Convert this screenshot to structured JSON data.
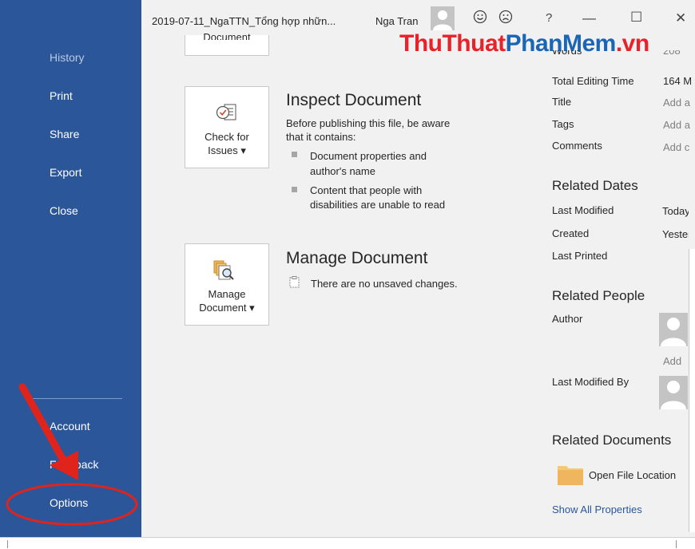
{
  "titlebar": {
    "doc_title": "2019-07-11_NgaTTN_Tổng hợp nhữn...",
    "user_name": "Nga Tran",
    "help_glyph": "?",
    "minimize_glyph": "—",
    "restore_glyph": "☐",
    "close_glyph": "✕",
    "icons": [
      "smile-icon",
      "frown-icon",
      "help-icon"
    ]
  },
  "watermark": {
    "part1": "ThuThuat",
    "part2": "PhanMem",
    "part3": ".vn"
  },
  "nav": {
    "history": "History",
    "print": "Print",
    "share": "Share",
    "export": "Export",
    "close": "Close",
    "account": "Account",
    "feedback": "Feedback",
    "options": "Options"
  },
  "top_tile": {
    "label": "Document"
  },
  "inspect": {
    "button_line1": "Check for",
    "button_line2": "Issues ▾",
    "title": "Inspect Document",
    "desc_line1": "Before publishing this file, be aware",
    "desc_line2": "that it contains:",
    "bullets": [
      {
        "line1": "Document properties and",
        "line2": "author's name"
      },
      {
        "line1": "Content that people with",
        "line2": "disabilities are unable to read"
      }
    ]
  },
  "manage": {
    "button_line1": "Manage",
    "button_line2": "Document ▾",
    "title": "Manage Document",
    "status": "There are no unsaved changes."
  },
  "properties": {
    "words_label": "Words",
    "words_value": "208",
    "rows": [
      {
        "label": "Total Editing Time",
        "value": "164 M"
      },
      {
        "label": "Title",
        "value": "Add a"
      },
      {
        "label": "Tags",
        "value": "Add a"
      },
      {
        "label": "Comments",
        "value": "Add c"
      }
    ]
  },
  "related_dates": {
    "heading": "Related Dates",
    "rows": [
      {
        "label": "Last Modified",
        "value": "Today"
      },
      {
        "label": "Created",
        "value": "Yester"
      },
      {
        "label": "Last Printed",
        "value": ""
      }
    ]
  },
  "related_people": {
    "heading": "Related People",
    "author_label": "Author",
    "add_author": "Add",
    "last_modified_by_label": "Last Modified By"
  },
  "related_documents": {
    "heading": "Related Documents",
    "open_location": "Open File Location",
    "show_all": "Show All Properties"
  },
  "colors": {
    "nav_bg": "#2b579a",
    "annotation_red": "#e0231b",
    "watermark_red": "#e8222b",
    "watermark_blue": "#1a66b5"
  }
}
